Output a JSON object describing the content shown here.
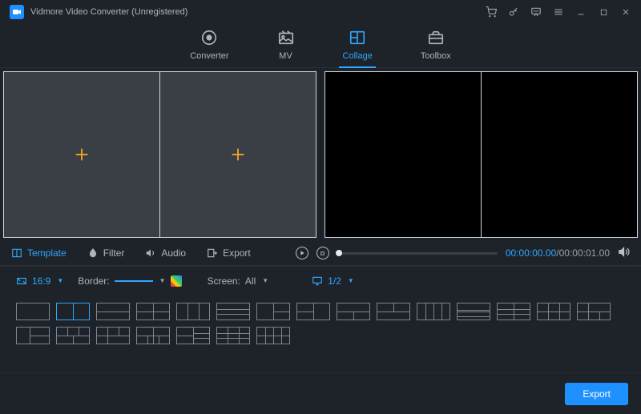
{
  "app": {
    "title": "Vidmore Video Converter (Unregistered)"
  },
  "nav": {
    "converter": "Converter",
    "mv": "MV",
    "collage": "Collage",
    "toolbox": "Toolbox"
  },
  "tabs": {
    "template": "Template",
    "filter": "Filter",
    "audio": "Audio",
    "export": "Export"
  },
  "playback": {
    "current": "00:00:00.00",
    "sep": "/",
    "total": "00:00:01.00"
  },
  "opts": {
    "ratio": "16:9",
    "border_label": "Border:",
    "screen_label": "Screen:",
    "screen_value": "All",
    "page": "1/2"
  },
  "footer": {
    "export": "Export"
  }
}
